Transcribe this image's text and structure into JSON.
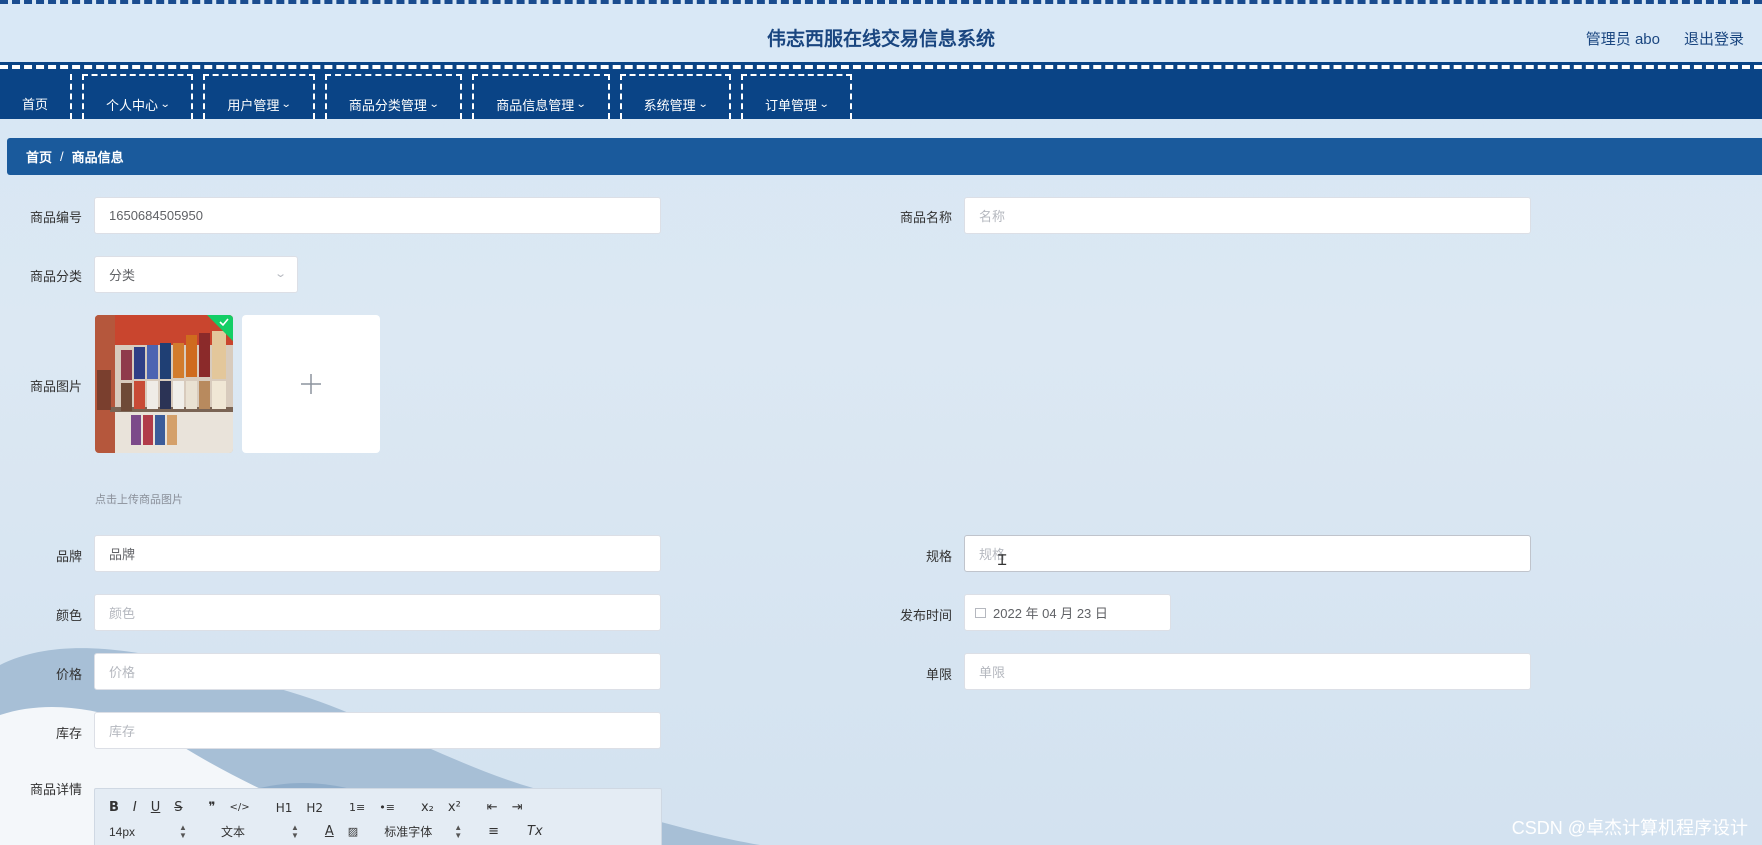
{
  "header": {
    "title": "伟志西服在线交易信息系统",
    "user": "管理员 abo",
    "logout": "退出登录"
  },
  "nav": {
    "items": [
      {
        "label": "首页",
        "has_dropdown": false
      },
      {
        "label": "个人中心",
        "has_dropdown": true
      },
      {
        "label": "用户管理",
        "has_dropdown": true
      },
      {
        "label": "商品分类管理",
        "has_dropdown": true
      },
      {
        "label": "商品信息管理",
        "has_dropdown": true
      },
      {
        "label": "系统管理",
        "has_dropdown": true
      },
      {
        "label": "订单管理",
        "has_dropdown": true
      }
    ]
  },
  "breadcrumb": {
    "home": "首页",
    "separator": "/",
    "current": "商品信息"
  },
  "form": {
    "product_no": {
      "label": "商品编号",
      "value": "1650684505950"
    },
    "product_name": {
      "label": "商品名称",
      "placeholder": "名称"
    },
    "category": {
      "label": "商品分类",
      "placeholder": "分类"
    },
    "image": {
      "label": "商品图片",
      "hint": "点击上传商品图片"
    },
    "brand": {
      "label": "品牌",
      "value": "品牌"
    },
    "spec": {
      "label": "规格",
      "placeholder": "规格"
    },
    "color": {
      "label": "颜色",
      "placeholder": "颜色"
    },
    "publish_time": {
      "label": "发布时间",
      "value": "2022 年 04 月 23 日"
    },
    "price": {
      "label": "价格",
      "placeholder": "价格"
    },
    "limit": {
      "label": "单限",
      "placeholder": "单限"
    },
    "stock": {
      "label": "库存",
      "placeholder": "库存"
    },
    "details": {
      "label": "商品详情"
    }
  },
  "editor": {
    "row1": [
      "B",
      "I",
      "U",
      "S",
      "❞",
      "</>",
      "H1",
      "H2",
      "1≡",
      "•≡",
      "x₂",
      "x²",
      "⇤",
      "⇥"
    ],
    "font_size": "14px",
    "block_type": "文本",
    "font_family": "标准字体",
    "clear_format": "Tx"
  },
  "watermark": "CSDN @卓杰计算机程序设计",
  "colors": {
    "nav_bg": "#0a4486",
    "breadcrumb_bg": "#1a5a9c",
    "title_color": "#1a4680",
    "page_bg": "#d6e6f4"
  }
}
